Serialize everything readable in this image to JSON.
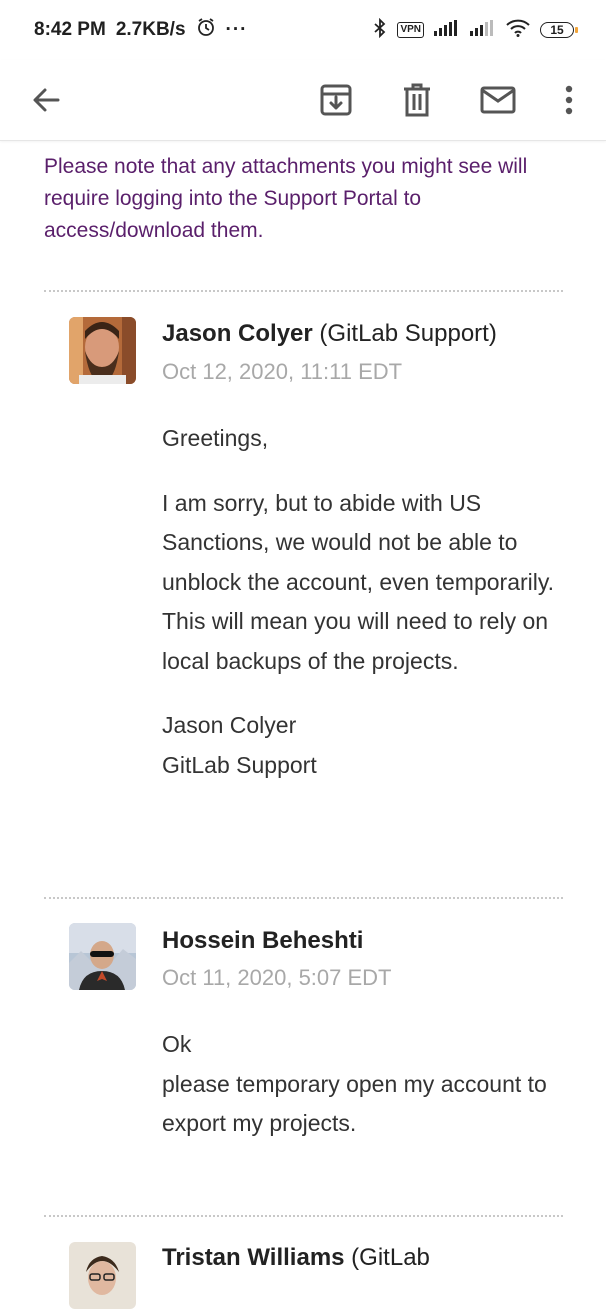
{
  "status_bar": {
    "time": "8:42 PM",
    "speed": "2.7KB/s",
    "more": "···",
    "vpn": "VPN",
    "battery": "15"
  },
  "toolbar": {
    "icons": [
      "back-arrow-icon",
      "archive-icon",
      "delete-icon",
      "mail-icon",
      "more-vert-icon"
    ]
  },
  "notice": "Please note that any attachments you might see will require logging into the Support Portal to access/download them.",
  "messages": [
    {
      "sender_name": "Jason Colyer",
      "sender_org": " (GitLab Support)",
      "date": "Oct 12, 2020, 11:11 EDT",
      "greeting": "Greetings,",
      "paragraph": "I am sorry, but to abide with US Sanctions, we would not be able to unblock the account, even temporarily. This will mean you will need to rely on local backups of the projects.",
      "signature_name": "Jason Colyer",
      "signature_org": "GitLab Support"
    },
    {
      "sender_name": "Hossein Beheshti",
      "date": "Oct 11, 2020, 5:07 EDT",
      "line1": "Ok",
      "line2": "please temporary open my account to export my projects."
    },
    {
      "sender_name": "Tristan Williams",
      "sender_org": " (GitLab"
    }
  ],
  "colors": {
    "notice_text": "#5a1f6b",
    "date_text": "#a8a8a8",
    "icon": "#555555"
  }
}
